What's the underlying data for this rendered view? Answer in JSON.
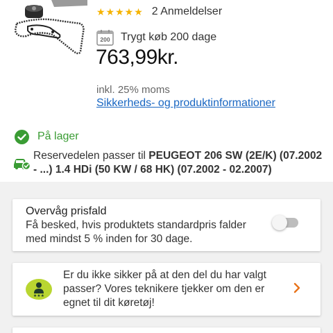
{
  "product": {
    "image_icon": "timing-belt-kit-with-water-pump",
    "rating": {
      "stars_glyph": "★★★★★",
      "stars_color": "#f5b301",
      "reviews_label": "2 Anmeldelser"
    },
    "returns": {
      "icon": "calendar-200-icon",
      "icon_text": "200",
      "label": "Trygt køb 200 dage"
    },
    "price": "763,99kr.",
    "vat_note": "inkl. 25% moms",
    "info_link": "Sikkerheds- og produktinformationer"
  },
  "stock": {
    "icon": "check-circle-icon",
    "label": "På lager",
    "color": "#3a9c34"
  },
  "fitment": {
    "icon": "car-check-icon",
    "prefix": "Reservedelen passer til ",
    "vehicle": "PEUGEOT 206 SW (2E/K) (07.2002 - ...) 1.4 HDi (50 KW / 68 HK) (07.2002 - 02.2007)"
  },
  "price_alert": {
    "title": "Overvåg prisfald",
    "description": "Få besked, hvis produktets standardpris falder med mindst 5 % inden for 30 dage.",
    "toggle_on": false
  },
  "help": {
    "icon": "mechanic-support-icon",
    "text": "Er du ikke sikker på at den del du har valgt passer? Vores teknikere tjekker om den er egnet  til dit køretøj!",
    "chevron": "chevron-right-icon",
    "accent": "#e8731a"
  }
}
